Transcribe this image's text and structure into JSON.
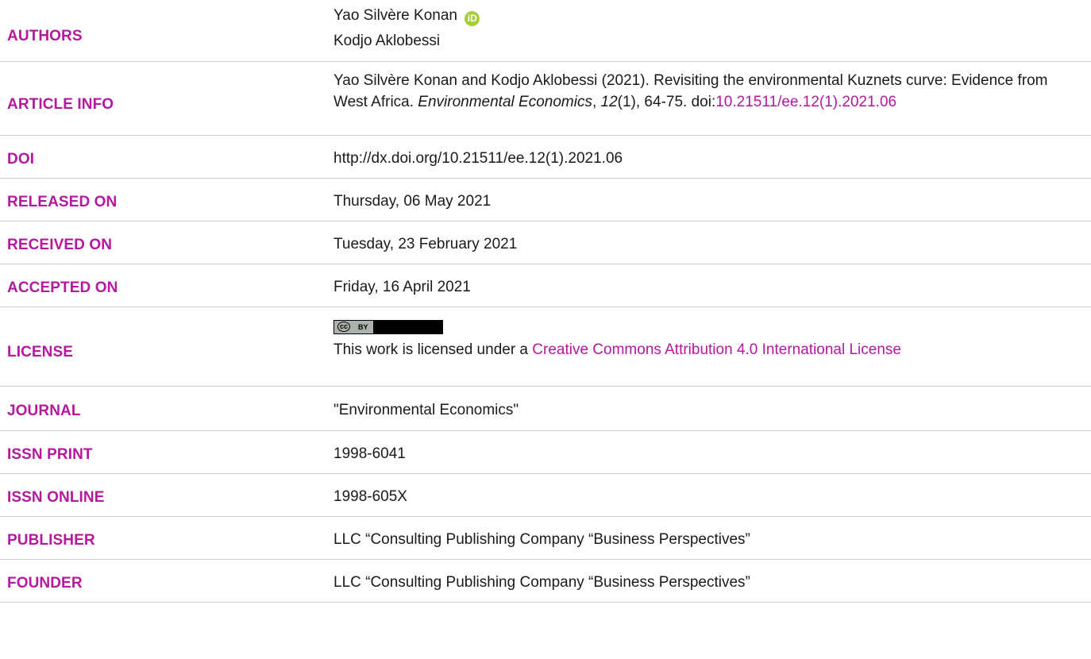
{
  "colors": {
    "label": "#b5179e",
    "link": "#b5179e",
    "orcid": "#a6ce39"
  },
  "authors": {
    "label": "AUTHORS",
    "names": [
      "Yao Silvère Konan",
      "Kodjo Aklobessi"
    ],
    "orcid_icon_text": "iD"
  },
  "article_info": {
    "label": "ARTICLE INFO",
    "text_before": "Yao Silvère Konan and Kodjo Aklobessi (2021). Revisiting the environmental Kuznets curve: Evidence from West Africa. ",
    "journal_italic": "Environmental Economics",
    "sep1": ", ",
    "volume_italic": "12",
    "text_after": "(1), 64-75. doi:",
    "doi_link": "10.21511/ee.12(1).2021.06"
  },
  "doi": {
    "label": "DOI",
    "value": "http://dx.doi.org/10.21511/ee.12(1).2021.06"
  },
  "released_on": {
    "label": "RELEASED ON",
    "value": "Thursday, 06 May 2021"
  },
  "received_on": {
    "label": "RECEIVED ON",
    "value": "Tuesday, 23 February 2021"
  },
  "accepted_on": {
    "label": "ACCEPTED ON",
    "value": "Friday, 16 April 2021"
  },
  "license": {
    "label": "LICENSE",
    "badge_cc": "cc",
    "badge_by": "BY",
    "text_before": "This work is licensed under a ",
    "link": "Creative Commons Attribution 4.0 International License"
  },
  "journal": {
    "label": "JOURNAL",
    "value": "\"Environmental Economics\""
  },
  "issn_print": {
    "label": "ISSN PRINT",
    "value": "1998-6041"
  },
  "issn_online": {
    "label": "ISSN ONLINE",
    "value": "1998-605X"
  },
  "publisher": {
    "label": "PUBLISHER",
    "value": "LLC “Consulting Publishing Company “Business Perspectives”"
  },
  "founder": {
    "label": "FOUNDER",
    "value": "LLC “Consulting Publishing Company “Business Perspectives”"
  }
}
